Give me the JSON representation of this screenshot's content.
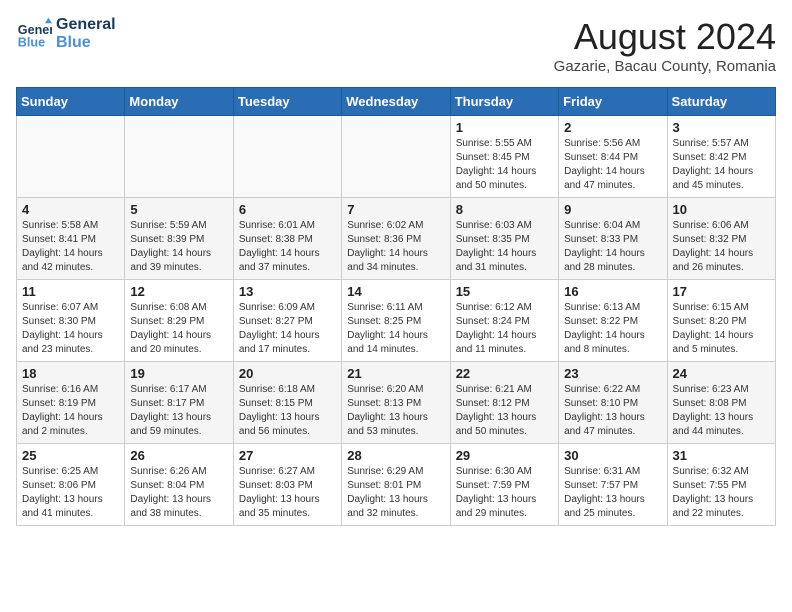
{
  "header": {
    "logo_line1": "General",
    "logo_line2": "Blue",
    "title": "August 2024",
    "subtitle": "Gazarie, Bacau County, Romania"
  },
  "weekdays": [
    "Sunday",
    "Monday",
    "Tuesday",
    "Wednesday",
    "Thursday",
    "Friday",
    "Saturday"
  ],
  "weeks": [
    [
      {
        "day": "",
        "info": ""
      },
      {
        "day": "",
        "info": ""
      },
      {
        "day": "",
        "info": ""
      },
      {
        "day": "",
        "info": ""
      },
      {
        "day": "1",
        "info": "Sunrise: 5:55 AM\nSunset: 8:45 PM\nDaylight: 14 hours and 50 minutes."
      },
      {
        "day": "2",
        "info": "Sunrise: 5:56 AM\nSunset: 8:44 PM\nDaylight: 14 hours and 47 minutes."
      },
      {
        "day": "3",
        "info": "Sunrise: 5:57 AM\nSunset: 8:42 PM\nDaylight: 14 hours and 45 minutes."
      }
    ],
    [
      {
        "day": "4",
        "info": "Sunrise: 5:58 AM\nSunset: 8:41 PM\nDaylight: 14 hours and 42 minutes."
      },
      {
        "day": "5",
        "info": "Sunrise: 5:59 AM\nSunset: 8:39 PM\nDaylight: 14 hours and 39 minutes."
      },
      {
        "day": "6",
        "info": "Sunrise: 6:01 AM\nSunset: 8:38 PM\nDaylight: 14 hours and 37 minutes."
      },
      {
        "day": "7",
        "info": "Sunrise: 6:02 AM\nSunset: 8:36 PM\nDaylight: 14 hours and 34 minutes."
      },
      {
        "day": "8",
        "info": "Sunrise: 6:03 AM\nSunset: 8:35 PM\nDaylight: 14 hours and 31 minutes."
      },
      {
        "day": "9",
        "info": "Sunrise: 6:04 AM\nSunset: 8:33 PM\nDaylight: 14 hours and 28 minutes."
      },
      {
        "day": "10",
        "info": "Sunrise: 6:06 AM\nSunset: 8:32 PM\nDaylight: 14 hours and 26 minutes."
      }
    ],
    [
      {
        "day": "11",
        "info": "Sunrise: 6:07 AM\nSunset: 8:30 PM\nDaylight: 14 hours and 23 minutes."
      },
      {
        "day": "12",
        "info": "Sunrise: 6:08 AM\nSunset: 8:29 PM\nDaylight: 14 hours and 20 minutes."
      },
      {
        "day": "13",
        "info": "Sunrise: 6:09 AM\nSunset: 8:27 PM\nDaylight: 14 hours and 17 minutes."
      },
      {
        "day": "14",
        "info": "Sunrise: 6:11 AM\nSunset: 8:25 PM\nDaylight: 14 hours and 14 minutes."
      },
      {
        "day": "15",
        "info": "Sunrise: 6:12 AM\nSunset: 8:24 PM\nDaylight: 14 hours and 11 minutes."
      },
      {
        "day": "16",
        "info": "Sunrise: 6:13 AM\nSunset: 8:22 PM\nDaylight: 14 hours and 8 minutes."
      },
      {
        "day": "17",
        "info": "Sunrise: 6:15 AM\nSunset: 8:20 PM\nDaylight: 14 hours and 5 minutes."
      }
    ],
    [
      {
        "day": "18",
        "info": "Sunrise: 6:16 AM\nSunset: 8:19 PM\nDaylight: 14 hours and 2 minutes."
      },
      {
        "day": "19",
        "info": "Sunrise: 6:17 AM\nSunset: 8:17 PM\nDaylight: 13 hours and 59 minutes."
      },
      {
        "day": "20",
        "info": "Sunrise: 6:18 AM\nSunset: 8:15 PM\nDaylight: 13 hours and 56 minutes."
      },
      {
        "day": "21",
        "info": "Sunrise: 6:20 AM\nSunset: 8:13 PM\nDaylight: 13 hours and 53 minutes."
      },
      {
        "day": "22",
        "info": "Sunrise: 6:21 AM\nSunset: 8:12 PM\nDaylight: 13 hours and 50 minutes."
      },
      {
        "day": "23",
        "info": "Sunrise: 6:22 AM\nSunset: 8:10 PM\nDaylight: 13 hours and 47 minutes."
      },
      {
        "day": "24",
        "info": "Sunrise: 6:23 AM\nSunset: 8:08 PM\nDaylight: 13 hours and 44 minutes."
      }
    ],
    [
      {
        "day": "25",
        "info": "Sunrise: 6:25 AM\nSunset: 8:06 PM\nDaylight: 13 hours and 41 minutes."
      },
      {
        "day": "26",
        "info": "Sunrise: 6:26 AM\nSunset: 8:04 PM\nDaylight: 13 hours and 38 minutes."
      },
      {
        "day": "27",
        "info": "Sunrise: 6:27 AM\nSunset: 8:03 PM\nDaylight: 13 hours and 35 minutes."
      },
      {
        "day": "28",
        "info": "Sunrise: 6:29 AM\nSunset: 8:01 PM\nDaylight: 13 hours and 32 minutes."
      },
      {
        "day": "29",
        "info": "Sunrise: 6:30 AM\nSunset: 7:59 PM\nDaylight: 13 hours and 29 minutes."
      },
      {
        "day": "30",
        "info": "Sunrise: 6:31 AM\nSunset: 7:57 PM\nDaylight: 13 hours and 25 minutes."
      },
      {
        "day": "31",
        "info": "Sunrise: 6:32 AM\nSunset: 7:55 PM\nDaylight: 13 hours and 22 minutes."
      }
    ]
  ]
}
